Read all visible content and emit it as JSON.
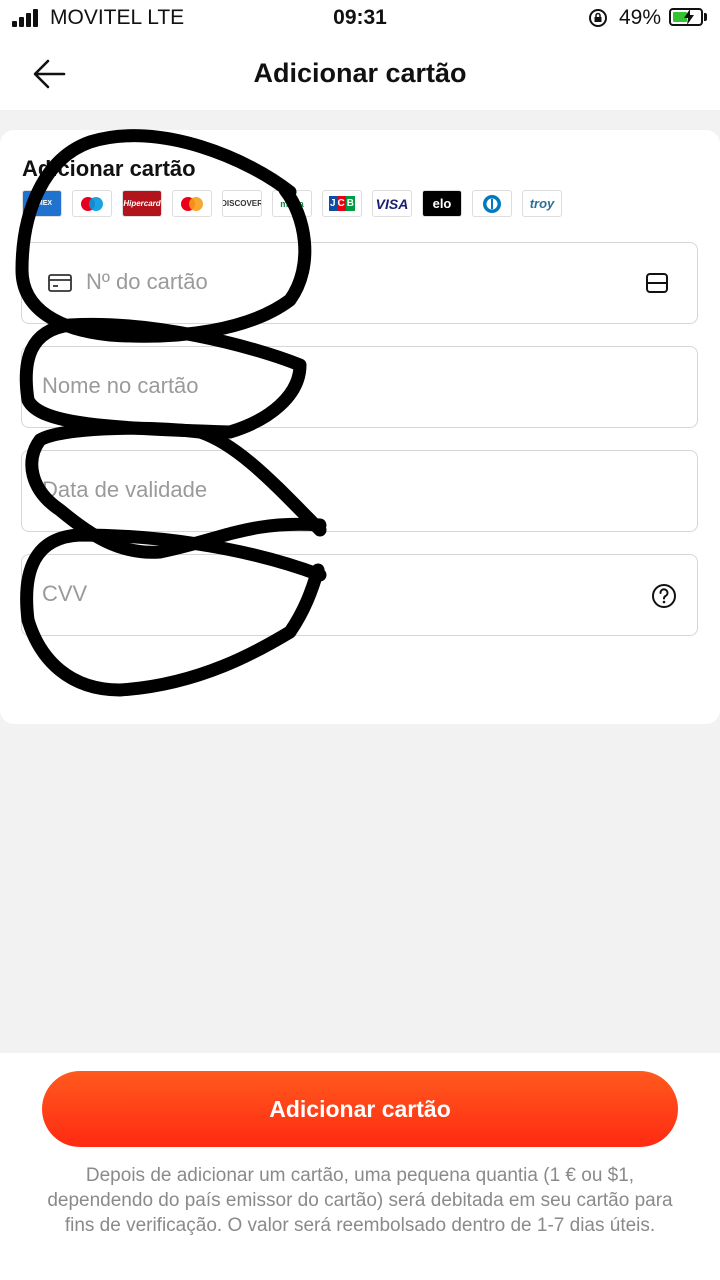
{
  "status_bar": {
    "carrier": "MOVITEL  LTE",
    "time": "09:31",
    "battery": "49%",
    "battery_level": 0.49
  },
  "header": {
    "title": "Adicionar cartão",
    "back_icon": "arrow-left-icon"
  },
  "card_form": {
    "section_title": "Adicionar cartão",
    "accepted_cards": [
      "American Express",
      "Maestro",
      "Hipercard",
      "Mastercard",
      "Discover",
      "Mada",
      "JCB",
      "VISA",
      "elo",
      "Diners Club",
      "troy"
    ],
    "fields": {
      "card_number": {
        "placeholder": "Nº do cartão",
        "icon": "credit-card-icon",
        "action_icon": "scan-icon"
      },
      "name": {
        "placeholder": "Nome no cartão"
      },
      "expiry": {
        "placeholder": "Data de validade"
      },
      "cvv": {
        "placeholder": "CVV",
        "action_icon": "help-icon"
      }
    }
  },
  "footer": {
    "button_label": "Adicionar cartão",
    "note": "Depois de adicionar um cartão, uma pequena quantia (1 € ou $1, dependendo do país emissor do cartão) será debitada em seu cartão para fins de verificação. O valor será reembolsado dentro de 1-7 dias úteis."
  },
  "colors": {
    "accent": "#ff3a16",
    "background": "#f2f2f2"
  }
}
